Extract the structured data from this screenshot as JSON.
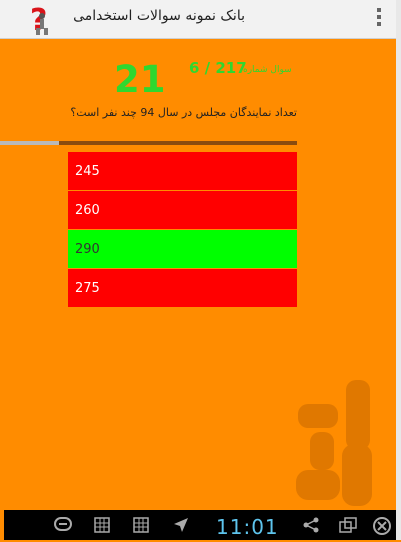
{
  "app": {
    "title": "بانک نمونه سوالات استخدامی",
    "logo_icon": "question-mark-person-icon",
    "menu_icon": "overflow-menu-icon"
  },
  "quiz": {
    "countdown": "21",
    "question_number_label": "سوال شماره",
    "question_number": "6 / 217",
    "question_text": "تعداد نمایندگان مجلس در سال 94 چند نفر است؟",
    "progress_fraction": 0.2,
    "options": [
      {
        "label": "245",
        "state": "wrong",
        "color": "#ff0000"
      },
      {
        "label": "260",
        "state": "wrong",
        "color": "#ff0000"
      },
      {
        "label": "290",
        "state": "correct",
        "color": "#00ff00"
      },
      {
        "label": "275",
        "state": "wrong",
        "color": "#ff0000"
      }
    ]
  },
  "system_bar": {
    "time": "11:01",
    "icons": [
      "line-app-icon",
      "keyboard-icon",
      "keyboard-icon",
      "location-icon",
      "share-icon",
      "window-icon",
      "close-icon"
    ]
  },
  "colors": {
    "background": "#ff8c00",
    "accent_green": "#2fd82f",
    "clock": "#5ec5ee"
  }
}
